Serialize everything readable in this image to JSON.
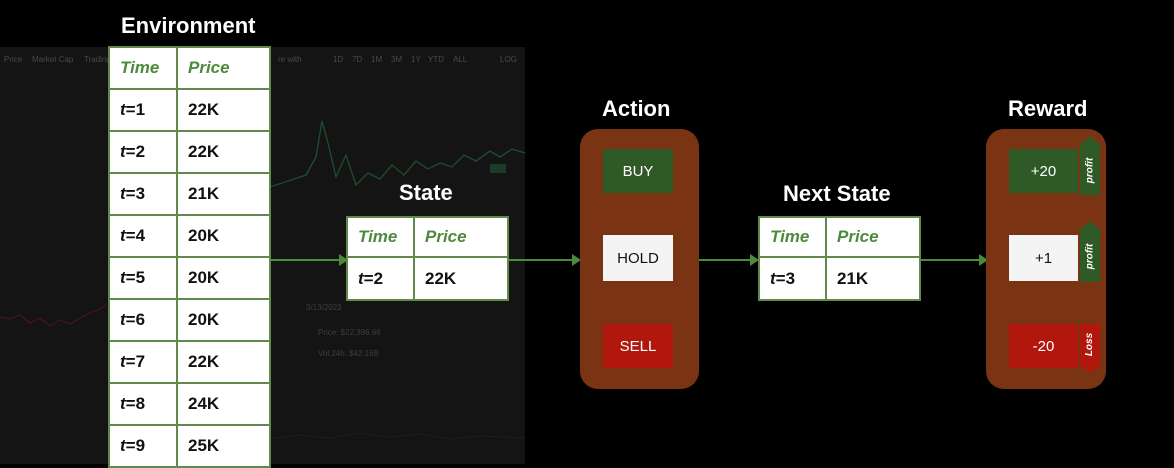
{
  "titles": {
    "environment": "Environment",
    "state": "State",
    "action": "Action",
    "next_state": "Next State",
    "reward": "Reward"
  },
  "columns": {
    "time": "Time",
    "price": "Price"
  },
  "environment_rows": [
    {
      "t": "=1",
      "price": "22K"
    },
    {
      "t": "=2",
      "price": "22K"
    },
    {
      "t": "=3",
      "price": "21K"
    },
    {
      "t": "=4",
      "price": "20K"
    },
    {
      "t": "=5",
      "price": "20K"
    },
    {
      "t": "=6",
      "price": "20K"
    },
    {
      "t": "=7",
      "price": "22K"
    },
    {
      "t": "=8",
      "price": "24K"
    },
    {
      "t": "=9",
      "price": "25K"
    }
  ],
  "t_symbol": "t",
  "state": {
    "t": "=2",
    "price": "22K"
  },
  "next_state": {
    "t": "=3",
    "price": "21K"
  },
  "actions": {
    "buy": "BUY",
    "hold": "HOLD",
    "sell": "SELL"
  },
  "rewards": {
    "buy": {
      "value": "+20",
      "tag": "profit"
    },
    "hold": {
      "value": "+1",
      "tag": "profit"
    },
    "sell": {
      "value": "-20",
      "tag": "Loss"
    }
  },
  "background_chart": {
    "toolbar": [
      "Price",
      "Market Cap",
      "Trading",
      "re with",
      "1D",
      "7D",
      "1M",
      "3M",
      "1Y",
      "YTD",
      "ALL",
      "LOG"
    ],
    "date": "3/13/2023",
    "price_label": "Price: $22,386.66",
    "vol_label": "Vol 24h: $42.16B"
  },
  "colors": {
    "green": "#4e8a3c",
    "panel": "#7a3414",
    "buy": "#2f5a26",
    "sell": "#b1170c"
  }
}
